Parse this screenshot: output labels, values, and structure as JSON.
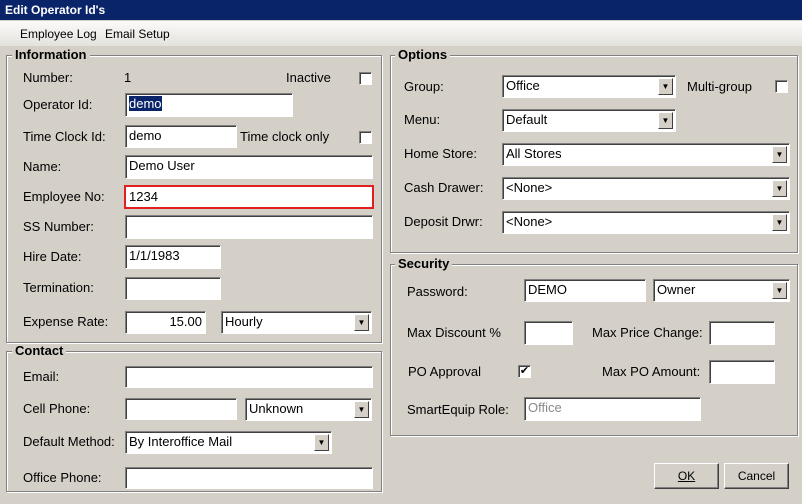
{
  "window": {
    "title": "Edit Operator Id's"
  },
  "menu": [
    "Employee Log",
    "Email Setup"
  ],
  "information": {
    "title": "Information",
    "number_label": "Number:",
    "number": "1",
    "inactive_label": "Inactive",
    "inactive": false,
    "operator_id_label": "Operator Id:",
    "operator_id": "demo",
    "time_clock_id_label": "Time Clock Id:",
    "time_clock_id": "demo",
    "time_clock_only_label": "Time clock only",
    "time_clock_only": false,
    "name_label": "Name:",
    "name": "Demo User",
    "employee_no_label": "Employee No:",
    "employee_no": "1234",
    "ss_label": "SS Number:",
    "ss": "",
    "hire_date_label": "Hire Date:",
    "hire_date": "1/1/1983",
    "termination_label": "Termination:",
    "termination": "",
    "expense_rate_label": "Expense Rate:",
    "expense_rate": "15.00",
    "rate_type": "Hourly"
  },
  "contact": {
    "title": "Contact",
    "email_label": "Email:",
    "email": "",
    "cell_label": "Cell Phone:",
    "cell": "",
    "cell_type": "Unknown",
    "method_label": "Default Method:",
    "method": "By Interoffice Mail",
    "office_label": "Office Phone:",
    "office": ""
  },
  "options": {
    "title": "Options",
    "group_label": "Group:",
    "group": "Office",
    "multigroup_label": "Multi-group",
    "multigroup": false,
    "menu_label": "Menu:",
    "menu": "Default",
    "home_store_label": "Home Store:",
    "home_store": "All Stores",
    "cash_drawer_label": "Cash Drawer:",
    "cash_drawer": "<None>",
    "deposit_label": "Deposit Drwr:",
    "deposit": "<None>"
  },
  "security": {
    "title": "Security",
    "password_label": "Password:",
    "password": "DEMO",
    "role": "Owner",
    "max_discount_label": "Max Discount %",
    "max_discount": "",
    "max_price_label": "Max Price Change:",
    "max_price": "",
    "po_approval_label": "PO Approval",
    "po_approval": true,
    "max_po_label": "Max PO Amount:",
    "max_po": "",
    "smartequip_label": "SmartEquip Role:",
    "smartequip": "Office"
  },
  "buttons": {
    "ok": "OK",
    "cancel": "Cancel"
  },
  "colors": {
    "titlebar": "#0a246a",
    "highlight": "#0a246a",
    "error_border": "#e02020"
  }
}
